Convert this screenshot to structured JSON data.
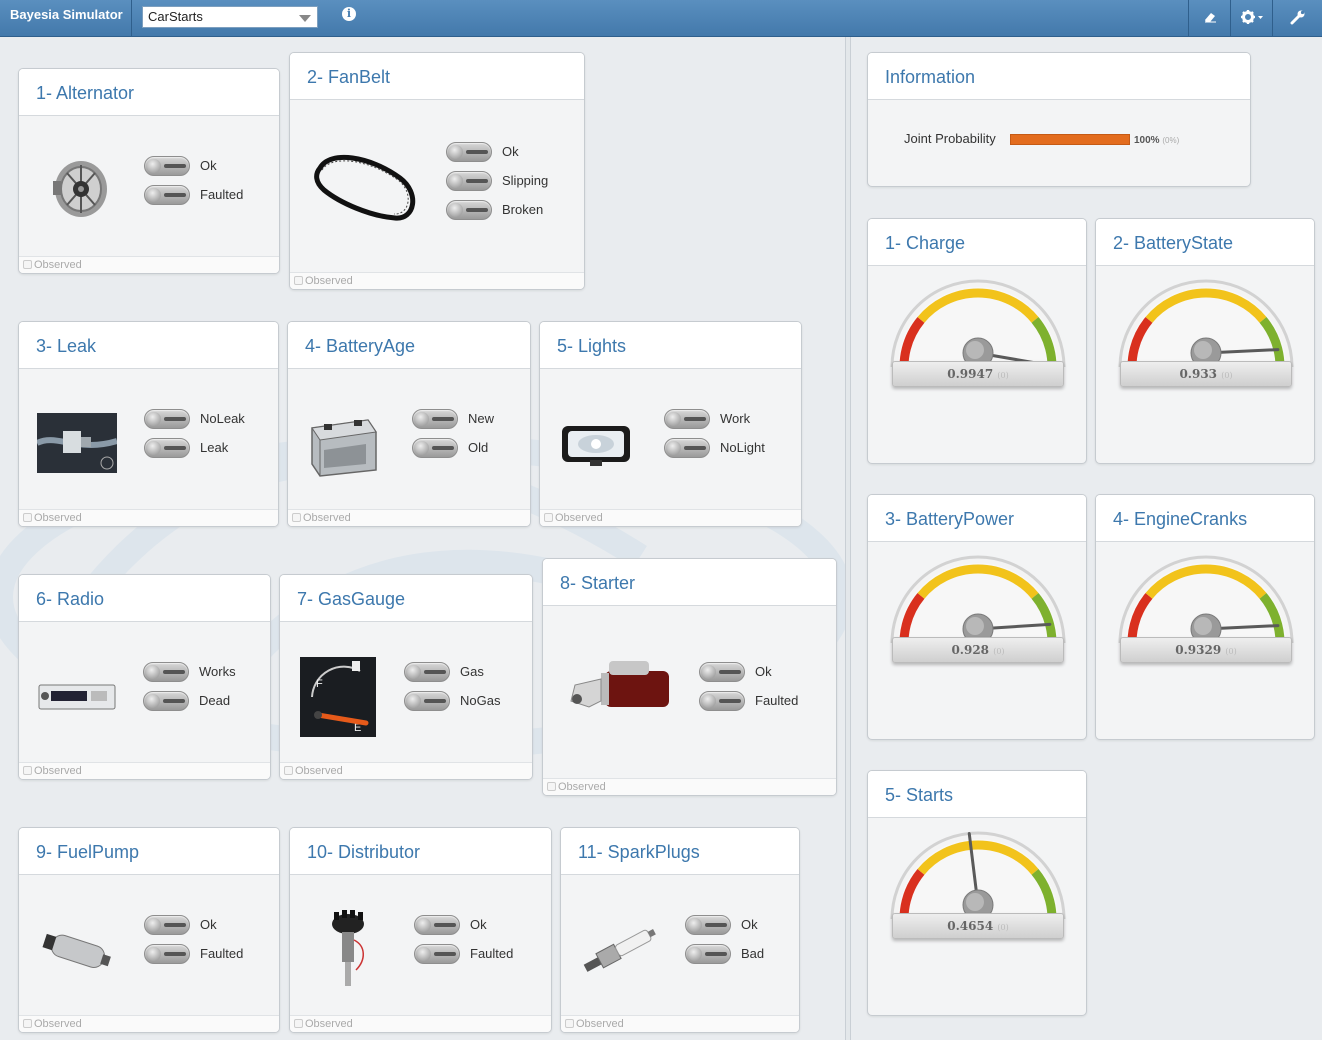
{
  "app": {
    "title": "Bayesia Simulator",
    "network_select": "CarStarts",
    "info_icon": "info-icon",
    "tools": [
      {
        "name": "eraser-icon",
        "glyph": "⌫"
      },
      {
        "name": "gear-icon",
        "glyph": "⚙▾"
      },
      {
        "name": "wrench-icon",
        "glyph": "🔧"
      }
    ]
  },
  "colors": {
    "header": "#4a80b2",
    "title_blue": "#3d78ad",
    "bar_orange": "#e36c1e",
    "gauge_red": "#d9301e",
    "gauge_yellow": "#f2c31b",
    "gauge_green": "#7eb12e"
  },
  "observed_label": "Observed",
  "nodes": [
    {
      "id": "alternator",
      "title": "1- Alternator",
      "states": [
        "Ok",
        "Faulted"
      ],
      "image": "alternator-image"
    },
    {
      "id": "fanbelt",
      "title": "2- FanBelt",
      "states": [
        "Ok",
        "Slipping",
        "Broken"
      ],
      "image": "fan-belt-image"
    },
    {
      "id": "leak",
      "title": "3- Leak",
      "states": [
        "NoLeak",
        "Leak"
      ],
      "image": "leak-image"
    },
    {
      "id": "batteryage",
      "title": "4- BatteryAge",
      "states": [
        "New",
        "Old"
      ],
      "image": "battery-image"
    },
    {
      "id": "lights",
      "title": "5- Lights",
      "states": [
        "Work",
        "NoLight"
      ],
      "image": "headlight-image"
    },
    {
      "id": "radio",
      "title": "6- Radio",
      "states": [
        "Works",
        "Dead"
      ],
      "image": "radio-image"
    },
    {
      "id": "gasgauge",
      "title": "7- GasGauge",
      "states": [
        "Gas",
        "NoGas"
      ],
      "image": "gas-gauge-image"
    },
    {
      "id": "starter",
      "title": "8- Starter",
      "states": [
        "Ok",
        "Faulted"
      ],
      "image": "starter-image"
    },
    {
      "id": "fuelpump",
      "title": "9- FuelPump",
      "states": [
        "Ok",
        "Faulted"
      ],
      "image": "fuel-pump-image"
    },
    {
      "id": "distributor",
      "title": "10- Distributor",
      "states": [
        "Ok",
        "Faulted"
      ],
      "image": "distributor-image"
    },
    {
      "id": "sparkplugs",
      "title": "11- SparkPlugs",
      "states": [
        "Ok",
        "Bad"
      ],
      "image": "spark-plug-image"
    }
  ],
  "information": {
    "title": "Information",
    "joint_label": "Joint Probability",
    "joint_value": "100%",
    "joint_sub": "(0%)",
    "joint_fraction": 1.0
  },
  "targets": [
    {
      "id": "charge",
      "title": "1- Charge",
      "value": 0.9947,
      "display": "0.9947",
      "sub": "(0)",
      "min_label": "0",
      "max_label": "1"
    },
    {
      "id": "batterystate",
      "title": "2- BatteryState",
      "value": 0.933,
      "display": "0.933",
      "sub": "(0)",
      "min_label": "0",
      "max_label": "1"
    },
    {
      "id": "batterypower",
      "title": "3- BatteryPower",
      "value": 0.928,
      "display": "0.928",
      "sub": "(0)",
      "min_label": "0",
      "max_label": "1"
    },
    {
      "id": "enginecranks",
      "title": "4- EngineCranks",
      "value": 0.9329,
      "display": "0.9329",
      "sub": "(0)",
      "min_label": "0",
      "max_label": "1"
    },
    {
      "id": "starts",
      "title": "5- Starts",
      "value": 0.4654,
      "display": "0.4654",
      "sub": "(0)",
      "min_label": "0",
      "max_label": "1"
    }
  ]
}
